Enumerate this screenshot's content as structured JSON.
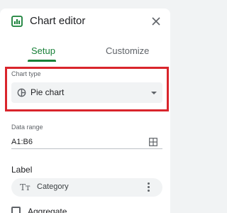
{
  "panel": {
    "title": "Chart editor",
    "icons": {
      "chart": "chart-icon",
      "close": "close-icon"
    },
    "tabs": [
      {
        "label": "Setup",
        "active": true
      },
      {
        "label": "Customize",
        "active": false
      }
    ],
    "accent_color": "#188038",
    "highlight_color": "#d9252c"
  },
  "chart_type": {
    "label": "Chart type",
    "value": "Pie chart",
    "icon": "pie-chart-icon"
  },
  "data_range": {
    "label": "Data range",
    "value": "A1:B6",
    "icon": "grid-icon"
  },
  "label_section": {
    "heading": "Label",
    "chip_value": "Category",
    "chip_icon": "text-type-icon",
    "chip_icon_text": "Tт",
    "menu_icon": "more-vert-icon"
  },
  "aggregate": {
    "label": "Aggregate",
    "checked": false
  }
}
